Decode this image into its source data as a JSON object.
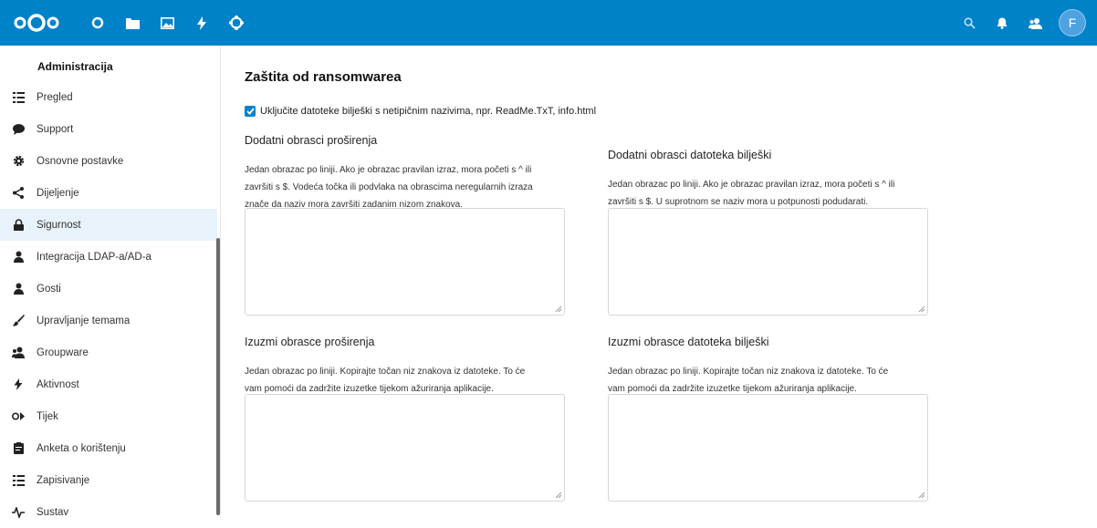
{
  "header": {
    "bg": "#0082c9",
    "apps": [
      "dashboard-icon",
      "files-icon",
      "photos-icon",
      "activity-icon",
      "circles-icon"
    ],
    "right": [
      "search-icon",
      "notifications-icon",
      "contacts-icon"
    ],
    "avatar_letter": "F"
  },
  "sidebar": {
    "heading": "Administracija",
    "items": [
      {
        "label": "Pregled",
        "icon": "overview-list-icon"
      },
      {
        "label": "Support",
        "icon": "speech-bubble-icon"
      },
      {
        "label": "Osnovne postavke",
        "icon": "gear-icon"
      },
      {
        "label": "Dijeljenje",
        "icon": "share-icon"
      },
      {
        "label": "Sigurnost",
        "icon": "lock-icon",
        "active": true
      },
      {
        "label": "Integracija LDAP-a/AD-a",
        "icon": "user-icon"
      },
      {
        "label": "Gosti",
        "icon": "guest-user-icon"
      },
      {
        "label": "Upravljanje temama",
        "icon": "paint-brush-icon"
      },
      {
        "label": "Groupware",
        "icon": "group-icon"
      },
      {
        "label": "Aktivnost",
        "icon": "lightning-icon"
      },
      {
        "label": "Tijek",
        "icon": "flow-icon"
      },
      {
        "label": "Anketa o korištenju",
        "icon": "clipboard-icon"
      },
      {
        "label": "Zapisivanje",
        "icon": "log-list-icon"
      },
      {
        "label": "Sustav",
        "icon": "pulse-icon"
      }
    ]
  },
  "main": {
    "title": "Zaštita od ransomwarea",
    "checkbox_label": "Uključite datoteke bilješki s netipičnim nazivima, npr. ReadMe.TxT, info.html",
    "checkbox_checked": true,
    "sections": {
      "ext_patterns": {
        "title": "Dodatni obrasci proširenja",
        "desc": [
          "Jedan obrazac po liniji. Ako je obrazac pravilan izraz, mora početi s ^ ili",
          "završiti s $. Vodeća točka ili podvlaka na obrascima neregularnih izraza",
          "znače da naziv mora završiti zadanim nizom znakova."
        ]
      },
      "note_patterns": {
        "title": "Dodatni obrasci datoteka bilješki",
        "desc": [
          "Jedan obrazac po liniji. Ako je obrazac pravilan izraz, mora početi s ^ ili",
          "završiti s $. U suprotnom se naziv mora u potpunosti podudarati."
        ]
      },
      "ext_exclude": {
        "title": "Izuzmi obrasce proširenja",
        "desc": [
          "Jedan obrazac po liniji. Kopirajte točan niz znakova iz datoteke. To će",
          "vam pomoći da zadržite izuzetke tijekom ažuriranja aplikacije."
        ]
      },
      "note_exclude": {
        "title": "Izuzmi obrasce datoteka bilješki",
        "desc": [
          "Jedan obrazac po liniji. Kopirajte točan niz znakova iz datoteke. To će",
          "vam pomoći da zadržite izuzetke tijekom ažuriranja aplikacije."
        ]
      }
    }
  }
}
